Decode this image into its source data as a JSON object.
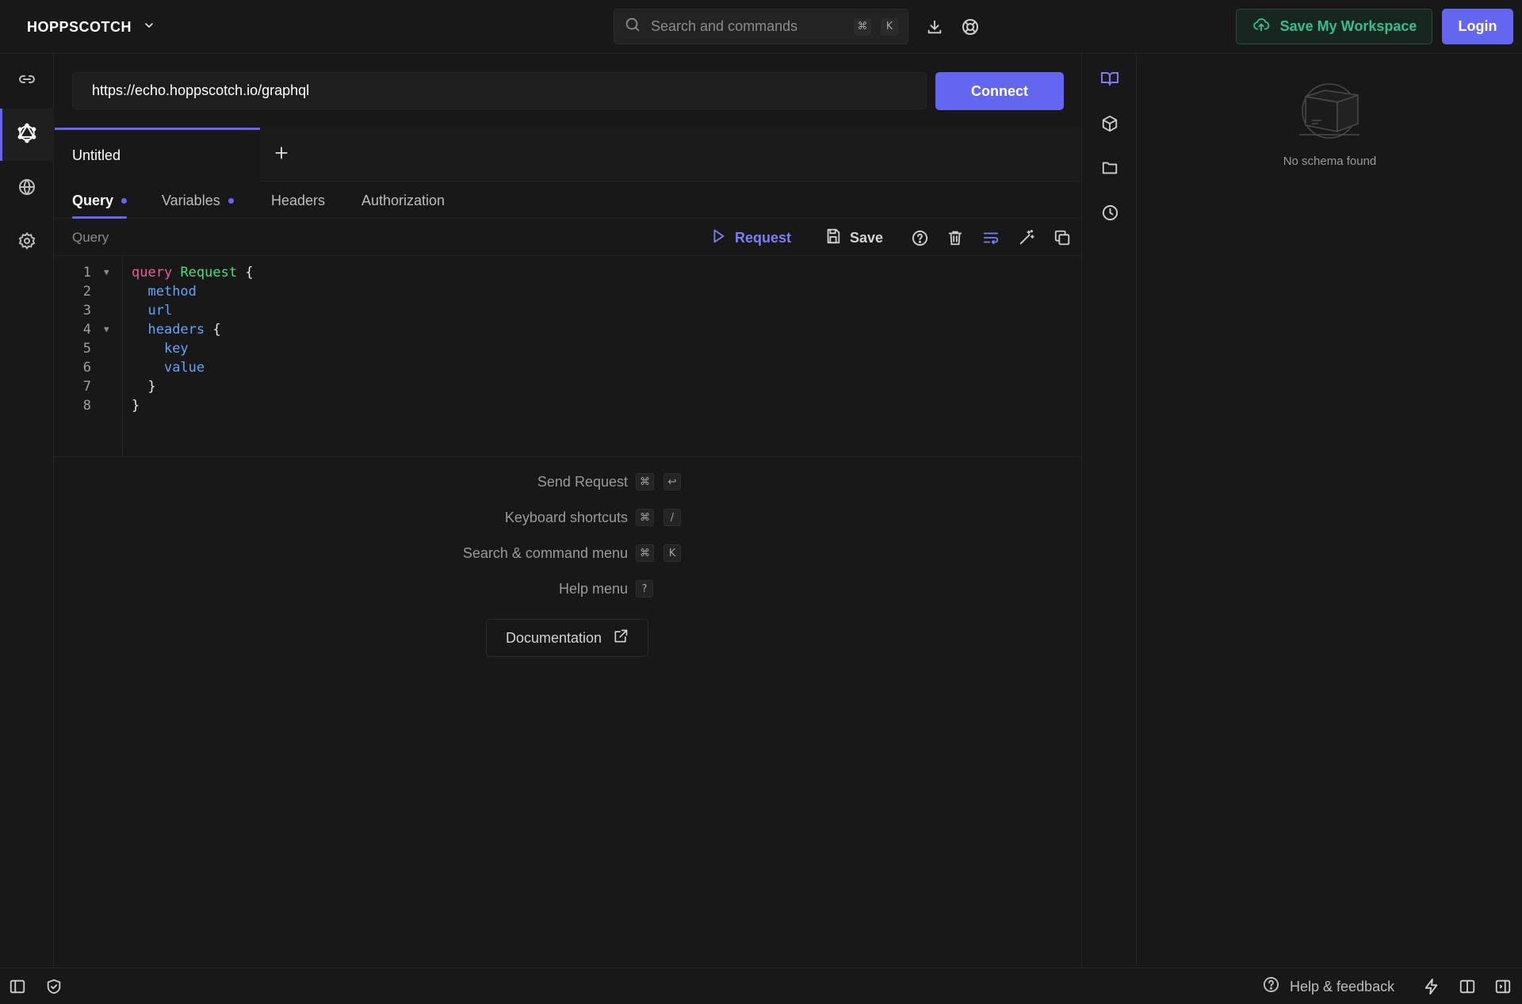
{
  "header": {
    "brand": "HOPPSCOTCH",
    "search_placeholder": "Search and commands",
    "search_keys": [
      "⌘",
      "K"
    ],
    "save_workspace_label": "Save My Workspace",
    "login_label": "Login"
  },
  "left_nav": {
    "items": [
      {
        "icon": "link-icon",
        "name": "REST"
      },
      {
        "icon": "graphql-icon",
        "name": "GraphQL",
        "active": true
      },
      {
        "icon": "globe-icon",
        "name": "Realtime"
      },
      {
        "icon": "gear-icon",
        "name": "Settings"
      }
    ]
  },
  "request": {
    "url": "https://echo.hoppscotch.io/graphql",
    "connect_label": "Connect"
  },
  "tabs": [
    {
      "label": "Untitled",
      "active": true
    }
  ],
  "subtabs": [
    {
      "label": "Query",
      "active": true,
      "dot": true
    },
    {
      "label": "Variables",
      "active": false,
      "dot": true
    },
    {
      "label": "Headers",
      "active": false,
      "dot": false
    },
    {
      "label": "Authorization",
      "active": false,
      "dot": false
    }
  ],
  "toolbar": {
    "label": "Query",
    "request_label": "Request",
    "save_label": "Save"
  },
  "editor": {
    "line_numbers": [
      "1",
      "2",
      "3",
      "4",
      "5",
      "6",
      "7",
      "8"
    ],
    "lines": {
      "l1_kw": "query",
      "l1_type": "Request",
      "l1_brace": "{",
      "l2": "method",
      "l3": "url",
      "l4": "headers",
      "l4_brace": "{",
      "l5": "key",
      "l6": "value",
      "l7": "}",
      "l8": "}"
    }
  },
  "shortcuts": [
    {
      "label": "Send Request",
      "keys": [
        "⌘",
        "↩"
      ]
    },
    {
      "label": "Keyboard shortcuts",
      "keys": [
        "⌘",
        "/"
      ]
    },
    {
      "label": "Search & command menu",
      "keys": [
        "⌘",
        "K"
      ]
    },
    {
      "label": "Help menu",
      "keys": [
        "?"
      ]
    }
  ],
  "documentation_label": "Documentation",
  "schema": {
    "empty_text": "No schema found"
  },
  "footer": {
    "help_label": "Help & feedback"
  },
  "colors": {
    "accent": "#6366f1",
    "background": "#181818",
    "success": "#34c08a"
  }
}
